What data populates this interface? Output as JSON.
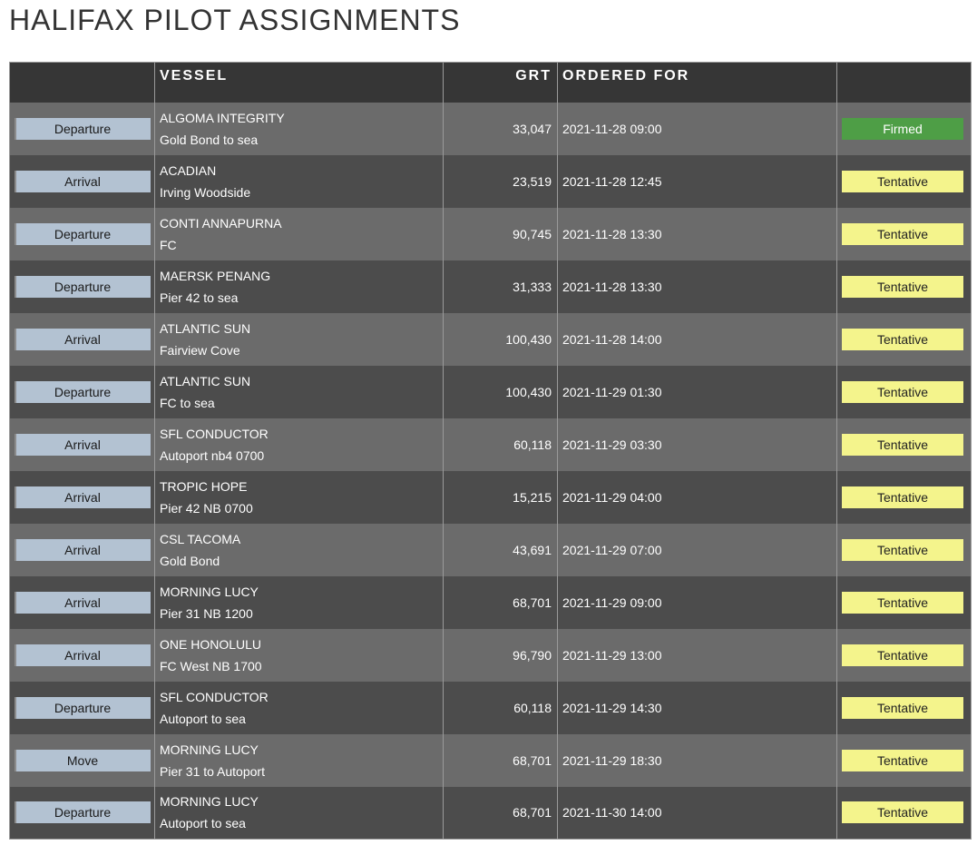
{
  "title": "HALIFAX PILOT ASSIGNMENTS",
  "columns": {
    "type": "",
    "vessel": "VESSEL",
    "grt": "GRT",
    "ordered_for": "ORDERED FOR",
    "status": ""
  },
  "colors": {
    "type_badge": "#b3c2d2",
    "tentative": "#f4f48c",
    "firmed": "#4e9e46",
    "header_bg": "#363636",
    "row_light": "#6b6b6b",
    "row_dark": "#4c4c4c"
  },
  "rows": [
    {
      "type": "Departure",
      "vessel": "ALGOMA INTEGRITY",
      "route": "Gold Bond to sea",
      "grt": "33,047",
      "ordered_for": "2021-11-28 09:00",
      "status": "Firmed"
    },
    {
      "type": "Arrival",
      "vessel": "ACADIAN",
      "route": "Irving Woodside",
      "grt": "23,519",
      "ordered_for": "2021-11-28 12:45",
      "status": "Tentative"
    },
    {
      "type": "Departure",
      "vessel": "CONTI ANNAPURNA",
      "route": "FC",
      "grt": "90,745",
      "ordered_for": "2021-11-28 13:30",
      "status": "Tentative"
    },
    {
      "type": "Departure",
      "vessel": "MAERSK PENANG",
      "route": "Pier 42 to sea",
      "grt": "31,333",
      "ordered_for": "2021-11-28 13:30",
      "status": "Tentative"
    },
    {
      "type": "Arrival",
      "vessel": "ATLANTIC SUN",
      "route": "Fairview Cove",
      "grt": "100,430",
      "ordered_for": "2021-11-28 14:00",
      "status": "Tentative"
    },
    {
      "type": "Departure",
      "vessel": "ATLANTIC SUN",
      "route": "FC to sea",
      "grt": "100,430",
      "ordered_for": "2021-11-29 01:30",
      "status": "Tentative"
    },
    {
      "type": "Arrival",
      "vessel": "SFL CONDUCTOR",
      "route": "Autoport nb4 0700",
      "grt": "60,118",
      "ordered_for": "2021-11-29 03:30",
      "status": "Tentative"
    },
    {
      "type": "Arrival",
      "vessel": "TROPIC HOPE",
      "route": "Pier 42 NB 0700",
      "grt": "15,215",
      "ordered_for": "2021-11-29 04:00",
      "status": "Tentative"
    },
    {
      "type": "Arrival",
      "vessel": "CSL TACOMA",
      "route": "Gold Bond",
      "grt": "43,691",
      "ordered_for": "2021-11-29 07:00",
      "status": "Tentative"
    },
    {
      "type": "Arrival",
      "vessel": "MORNING LUCY",
      "route": "Pier 31 NB 1200",
      "grt": "68,701",
      "ordered_for": "2021-11-29 09:00",
      "status": "Tentative"
    },
    {
      "type": "Arrival",
      "vessel": "ONE HONOLULU",
      "route": "FC West NB 1700",
      "grt": "96,790",
      "ordered_for": "2021-11-29 13:00",
      "status": "Tentative"
    },
    {
      "type": "Departure",
      "vessel": "SFL CONDUCTOR",
      "route": "Autoport to sea",
      "grt": "60,118",
      "ordered_for": "2021-11-29 14:30",
      "status": "Tentative"
    },
    {
      "type": "Move",
      "vessel": "MORNING LUCY",
      "route": "Pier 31 to Autoport",
      "grt": "68,701",
      "ordered_for": "2021-11-29 18:30",
      "status": "Tentative"
    },
    {
      "type": "Departure",
      "vessel": "MORNING LUCY",
      "route": "Autoport to sea",
      "grt": "68,701",
      "ordered_for": "2021-11-30 14:00",
      "status": "Tentative"
    }
  ]
}
